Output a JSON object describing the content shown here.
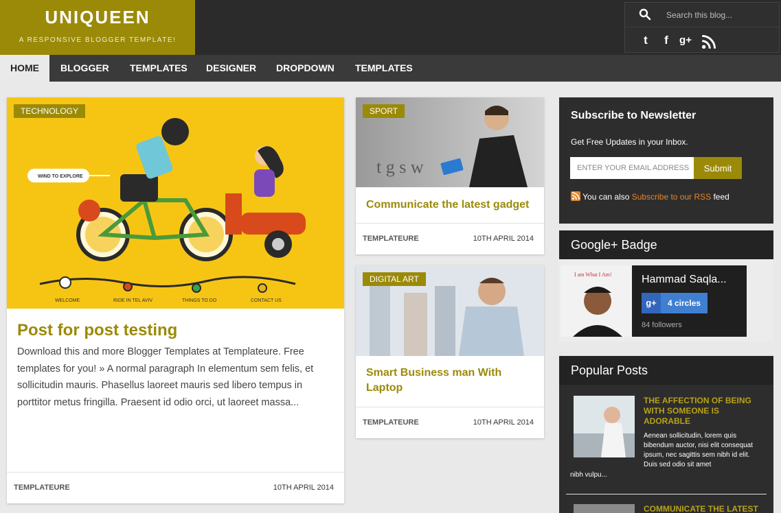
{
  "header": {
    "logo_title": "UNIQUEEN",
    "logo_tagline": "A RESPONSIVE BLOGGER TEMPLATE!",
    "search_placeholder": "Search this blog...",
    "social": [
      {
        "icon": "twitter-icon",
        "glyph": "t"
      },
      {
        "icon": "facebook-icon",
        "glyph": "f"
      },
      {
        "icon": "google-plus-icon",
        "glyph": "g+"
      },
      {
        "icon": "rss-icon",
        "glyph": ""
      }
    ]
  },
  "nav": {
    "items": [
      "HOME",
      "BLOGGER",
      "TEMPLATES",
      "DESIGNER",
      "DROPDOWN",
      "TEMPLATES"
    ],
    "active": "HOME"
  },
  "featured": {
    "category": "TECHNOLOGY",
    "illustration_labels": [
      "WIND TO EXPLORE",
      "WELCOME",
      "RIDE IN TEL AVIV",
      "THINGS TO DO",
      "CONTACT US"
    ],
    "title": "Post for post testing",
    "excerpt": "Download this and more Blogger Templates at Templateure. Free templates for you! » A normal paragraph In elementum sem felis, et sollicitudin mauris. Phasellus laoreet mauris sed libero tempus in porttitor metus fringilla. Praesent id odio orci, ut laoreet massa...",
    "author": "TEMPLATEURE",
    "date": "10TH APRIL 2014"
  },
  "posts": [
    {
      "category": "SPORT",
      "title": "Communicate the latest gadget",
      "author": "TEMPLATEURE",
      "date": "10TH APRIL 2014"
    },
    {
      "category": "DIGITAL ART",
      "title": "Smart Business man With Laptop",
      "author": "TEMPLATEURE",
      "date": "10TH APRIL 2014"
    }
  ],
  "newsletter": {
    "title": "Subscribe to Newsletter",
    "subtitle": "Get Free Updates in your Inbox.",
    "placeholder": "ENTER YOUR EMAIL ADDRESS",
    "submit": "Submit",
    "rss_prefix": "You can also ",
    "rss_link": "Subscribe to our RSS",
    "rss_suffix": " feed"
  },
  "gplus": {
    "heading": "Google+ Badge",
    "name": "Hammad Saqla...",
    "circles": "4 circles",
    "followers": "84 followers"
  },
  "popular": {
    "heading": "Popular Posts",
    "items": [
      {
        "title": "THE AFFECTION OF BEING WITH SOMEONE IS ADORABLE",
        "excerpt": "Aenean sollicitudin, lorem quis bibendum auctor, nisi elit consequat ipsum, nec sagittis sem nibh id elit. Duis sed odio sit amet",
        "excerpt_cont": "nibh vulpu..."
      },
      {
        "title": "COMMUNICATE THE LATEST"
      }
    ]
  },
  "colors": {
    "accent": "#9b8a08",
    "dark": "#2d2d2d",
    "nav": "#3a3a3a",
    "rss_link": "#e6862a"
  }
}
